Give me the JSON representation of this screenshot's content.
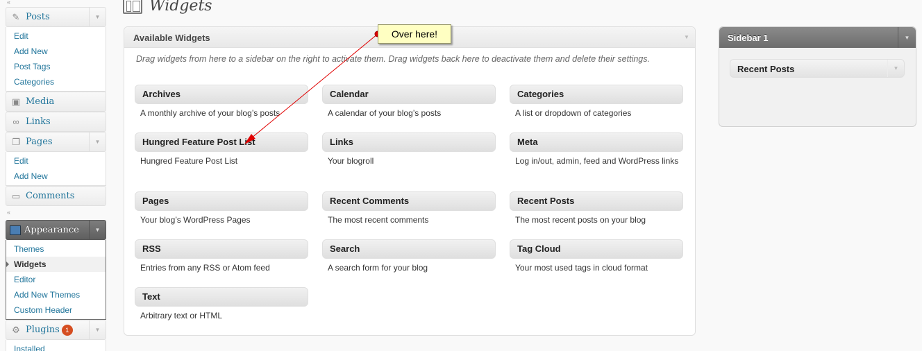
{
  "page": {
    "title": "Widgets"
  },
  "menu": {
    "posts": {
      "label": "Posts",
      "items": [
        "Edit",
        "Add New",
        "Post Tags",
        "Categories"
      ]
    },
    "media": {
      "label": "Media"
    },
    "links": {
      "label": "Links"
    },
    "pages": {
      "label": "Pages",
      "items": [
        "Edit",
        "Add New"
      ]
    },
    "comments": {
      "label": "Comments"
    },
    "appearance": {
      "label": "Appearance",
      "items": [
        "Themes",
        "Widgets",
        "Editor",
        "Add New Themes",
        "Custom Header"
      ],
      "active": "Widgets"
    },
    "plugins": {
      "label": "Plugins",
      "badge": "1",
      "items": [
        "Installed"
      ]
    }
  },
  "available": {
    "title": "Available Widgets",
    "description": "Drag widgets from here to a sidebar on the right to activate them. Drag widgets back here to deactivate them and delete their settings.",
    "widgets": [
      {
        "title": "Archives",
        "desc": "A monthly archive of your blog’s posts"
      },
      {
        "title": "Calendar",
        "desc": "A calendar of your blog’s posts"
      },
      {
        "title": "Categories",
        "desc": "A list or dropdown of categories"
      },
      {
        "title": "Hungred Feature Post List",
        "desc": "Hungred Feature Post List"
      },
      {
        "title": "Links",
        "desc": "Your blogroll"
      },
      {
        "title": "Meta",
        "desc": "Log in/out, admin, feed and WordPress links"
      },
      {
        "title": "Pages",
        "desc": "Your blog’s WordPress Pages"
      },
      {
        "title": "Recent Comments",
        "desc": "The most recent comments"
      },
      {
        "title": "Recent Posts",
        "desc": "The most recent posts on your blog"
      },
      {
        "title": "RSS",
        "desc": "Entries from any RSS or Atom feed"
      },
      {
        "title": "Search",
        "desc": "A search form for your blog"
      },
      {
        "title": "Tag Cloud",
        "desc": "Your most used tags in cloud format"
      },
      {
        "title": "Text",
        "desc": "Arbitrary text or HTML"
      }
    ]
  },
  "sidebar": {
    "title": "Sidebar 1",
    "widgets": [
      "Recent Posts"
    ]
  },
  "annotation": {
    "text": "Over here!",
    "color": "#e00000"
  },
  "icons": {
    "posts": "pushpin-icon",
    "media": "media-icon",
    "links": "link-icon",
    "pages": "pages-icon",
    "comments": "comment-icon",
    "appearance": "appearance-icon",
    "plugins": "plug-icon",
    "toggle": "triangle-down-icon"
  },
  "colors": {
    "link": "#21759b",
    "badge": "#d54e21",
    "current_menu": "#6d6d6d",
    "callout_bg": "#ffffc2"
  }
}
